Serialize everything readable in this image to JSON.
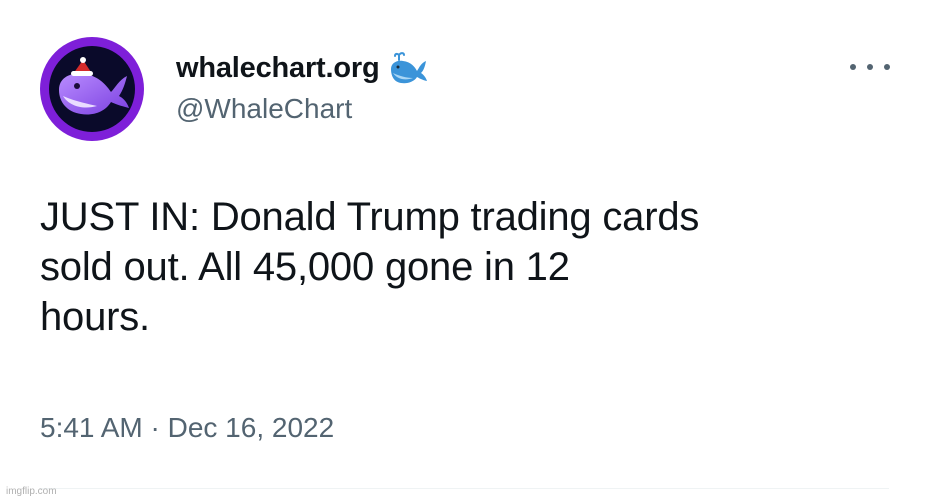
{
  "tweet": {
    "display_name": "whalechart.org",
    "handle": "@WhaleChart",
    "text": "JUST IN: Donald Trump trading cards\nsold out. All 45,000 gone in 12\nhours.",
    "timestamp": "5:41 AM · Dec 16, 2022",
    "verified_emoji": "whale-icon",
    "more_icon": "more-horizontal-icon"
  },
  "watermark": "imgflip.com",
  "colors": {
    "avatar_ring": "#7e1fd9",
    "avatar_bg": "#0a0a2a",
    "text": "#0f1419",
    "secondary_text": "#536471"
  }
}
